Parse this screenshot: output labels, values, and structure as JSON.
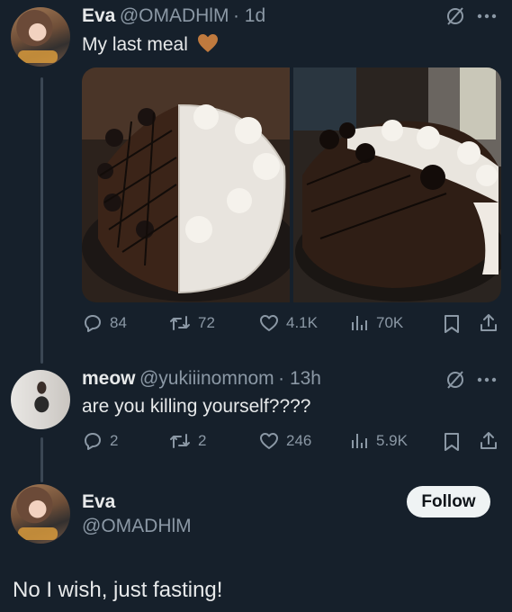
{
  "tweets": [
    {
      "name": "Eva",
      "handle": "@OMADHlM",
      "time": "· 1d",
      "text": "My last meal",
      "emoji": "brown-heart",
      "stats": {
        "replies": "84",
        "reposts": "72",
        "likes": "4.1K",
        "views": "70K"
      }
    },
    {
      "name": "meow",
      "handle": "@yukiiinomnom",
      "time": "· 13h",
      "text": "are you killing yourself????",
      "stats": {
        "replies": "2",
        "reposts": "2",
        "likes": "246",
        "views": "5.9K"
      }
    }
  ],
  "reply": {
    "name": "Eva",
    "handle": "@OMADHlM",
    "follow_label": "Follow",
    "text": "No I wish, just fasting!"
  },
  "colors": {
    "background": "#16202b",
    "text": "#e7e9ea",
    "muted": "#8b98a5",
    "heart": "#c07a3e"
  },
  "icons": [
    "mute-icon",
    "more-icon",
    "reply-icon",
    "repost-icon",
    "like-icon",
    "views-icon",
    "bookmark-icon",
    "share-icon"
  ]
}
